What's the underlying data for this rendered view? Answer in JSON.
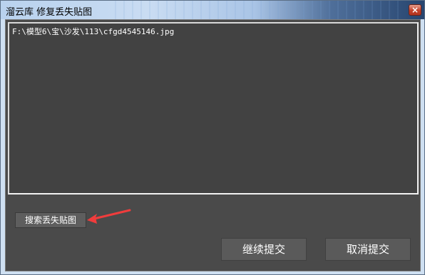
{
  "window": {
    "title": "溜云库 修复丢失贴图",
    "close_glyph": "×"
  },
  "file_list": {
    "items": [
      "F:\\模型6\\宝\\沙发\\113\\cfgd4545146.jpg"
    ]
  },
  "buttons": {
    "search_missing": "搜索丢失贴图",
    "continue_submit": "继续提交",
    "cancel_submit": "取消提交"
  },
  "annotation": {
    "arrow_icon": "red-arrow-icon",
    "arrow_color": "#f03c3c"
  }
}
